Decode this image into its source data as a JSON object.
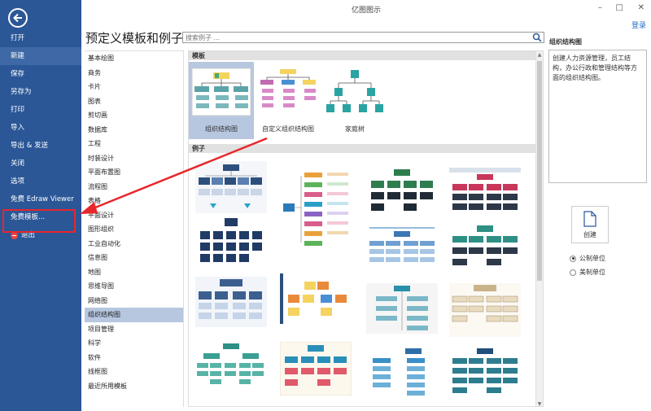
{
  "window": {
    "title": "亿图图示",
    "minimize": "–",
    "maximize": "□",
    "close": "✕",
    "login": "登录"
  },
  "sidebar": {
    "items": [
      {
        "id": "open",
        "label": "打开"
      },
      {
        "id": "new",
        "label": "新建"
      },
      {
        "id": "save",
        "label": "保存"
      },
      {
        "id": "save-as",
        "label": "另存为"
      },
      {
        "id": "print",
        "label": "打印"
      },
      {
        "id": "import",
        "label": "导入"
      },
      {
        "id": "export-send",
        "label": "导出 & 发送"
      },
      {
        "id": "close",
        "label": "关闭"
      },
      {
        "id": "options",
        "label": "选项"
      },
      {
        "id": "free-viewer",
        "label": "免费 Edraw Viewer"
      },
      {
        "id": "free-templates",
        "label": "免费模板..."
      },
      {
        "id": "exit",
        "label": "退出"
      }
    ]
  },
  "main": {
    "heading": "预定义模板和例子",
    "search_placeholder": "搜索例子 ..."
  },
  "categories": [
    "基本绘图",
    "商务",
    "卡片",
    "图表",
    "剪切画",
    "数据库",
    "工程",
    "时装设计",
    "平面布置图",
    "流程图",
    "表格",
    "平面设计",
    "图形组织",
    "工业自动化",
    "信息图",
    "地图",
    "思维导图",
    "网络图",
    "组织结构图",
    "项目管理",
    "科学",
    "软件",
    "线框图",
    "最近所用模板"
  ],
  "selected_category": "组织结构图",
  "templates_section": {
    "label": "模板"
  },
  "templates": [
    {
      "id": "org-chart",
      "label": "组织结构图"
    },
    {
      "id": "custom-org-chart",
      "label": "自定义组织结构图"
    },
    {
      "id": "family-tree",
      "label": "家庭树"
    }
  ],
  "examples_section": {
    "label": "例子"
  },
  "right_panel": {
    "title": "组织结构图",
    "description": "创建人力资源管理，员工结构，办公行政和管理结构等方面的组织结构图。",
    "create_label": "创建",
    "units": [
      {
        "label": "公制单位",
        "selected": true
      },
      {
        "label": "美制单位",
        "selected": false
      }
    ]
  },
  "colors": {
    "sidebar": "#2b5797",
    "highlight": "#e8262b",
    "selection": "#b7c7e0",
    "link": "#2b6cc4"
  }
}
